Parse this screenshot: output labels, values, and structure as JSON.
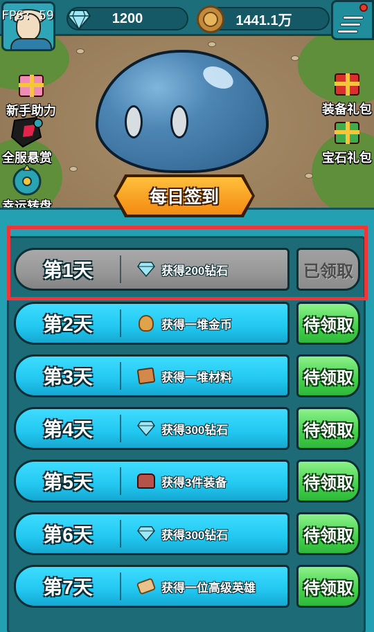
{
  "hud": {
    "fps": "FPS: 59",
    "diamonds": "1200",
    "gold": "1441.1万"
  },
  "left_menu": [
    {
      "label": "新手助力",
      "icon": "gift-icon"
    },
    {
      "label": "全服悬赏",
      "icon": "bounty-icon"
    },
    {
      "label": "幸运转盘",
      "icon": "wheel-icon"
    }
  ],
  "right_menu": [
    {
      "label": "装备礼包",
      "icon": "gift-icon"
    },
    {
      "label": "宝石礼包",
      "icon": "gift-icon"
    }
  ],
  "daily": {
    "title": "每日签到",
    "days": [
      {
        "day": "第1天",
        "reward": "获得200钻石",
        "icon": "diamond-icon",
        "status": "已领取",
        "claimed": true
      },
      {
        "day": "第2天",
        "reward": "获得一堆金币",
        "icon": "coins-icon",
        "status": "待领取",
        "claimed": false
      },
      {
        "day": "第3天",
        "reward": "获得一堆材料",
        "icon": "box-icon",
        "status": "待领取",
        "claimed": false
      },
      {
        "day": "第4天",
        "reward": "获得300钻石",
        "icon": "diamond-icon",
        "status": "待领取",
        "claimed": false
      },
      {
        "day": "第5天",
        "reward": "获得3件装备",
        "icon": "chest-icon",
        "status": "待领取",
        "claimed": false
      },
      {
        "day": "第6天",
        "reward": "获得300钻石",
        "icon": "diamond-icon",
        "status": "待领取",
        "claimed": false
      },
      {
        "day": "第7天",
        "reward": "获得一位高级英雄",
        "icon": "scroll-icon",
        "status": "待领取",
        "claimed": false
      }
    ]
  },
  "colors": {
    "panel": "#23a0b1",
    "row_active": "#21c7f0",
    "row_done": "#979797",
    "claim_pending": "#44d04c",
    "highlight": "#ef3535"
  }
}
